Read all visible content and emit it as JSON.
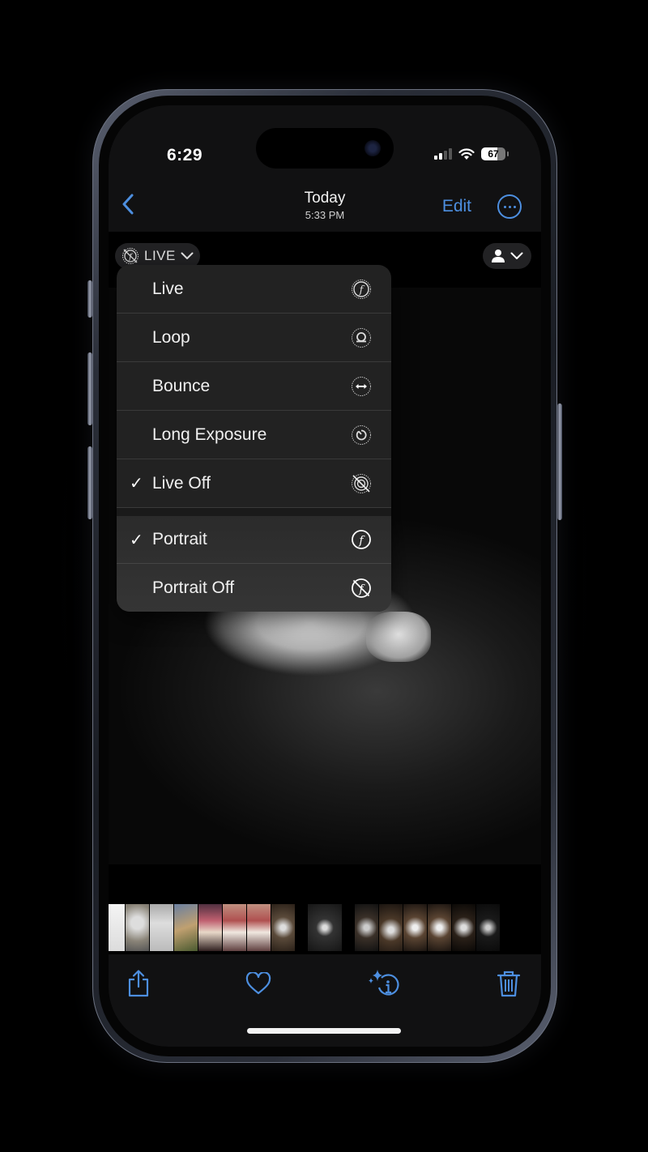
{
  "status_bar": {
    "time": "6:29",
    "battery": "67",
    "battery_level_percent": 67,
    "signal_bars_active": 2,
    "signal_bars_total": 4
  },
  "nav": {
    "back_icon": "chevron-left-icon",
    "title": "Today",
    "subtitle": "5:33 PM",
    "edit_label": "Edit",
    "more_icon": "ellipsis-circle-icon"
  },
  "photo_controls": {
    "live_pill_label": "LIVE",
    "live_pill_icon": "live-photo-off-icon",
    "person_pill_icon": "person-icon"
  },
  "menu": {
    "group1": [
      {
        "label": "Live",
        "icon": "live-photo-icon",
        "checked": false
      },
      {
        "label": "Loop",
        "icon": "loop-icon",
        "checked": false
      },
      {
        "label": "Bounce",
        "icon": "bounce-icon",
        "checked": false
      },
      {
        "label": "Long Exposure",
        "icon": "long-exposure-icon",
        "checked": false
      },
      {
        "label": "Live Off",
        "icon": "live-off-icon",
        "checked": true
      }
    ],
    "group2": [
      {
        "label": "Portrait",
        "icon": "portrait-aperture-icon",
        "checked": true
      },
      {
        "label": "Portrait Off",
        "icon": "portrait-off-icon",
        "checked": false
      }
    ],
    "check_glyph": "✓"
  },
  "filmstrip": {
    "thumbnails": [
      {
        "desc": "settings screenshot",
        "color": "#e8e8e8"
      },
      {
        "desc": "appliance photo",
        "color": "#8a8478"
      },
      {
        "desc": "messages screenshot",
        "color": "#b8b8b8"
      },
      {
        "desc": "outdoor sky photo",
        "color": "#7a6a4a"
      },
      {
        "desc": "laptop camera screenshot",
        "color": "#7a4a5a"
      },
      {
        "desc": "laptop photo",
        "color": "#a08070"
      },
      {
        "desc": "laptop photo",
        "color": "#a08070"
      },
      {
        "desc": "cat camera screenshot",
        "color": "#5a4a3a"
      },
      {
        "desc": "cat black and white (current)",
        "color": "#222222"
      },
      {
        "desc": "phone photo of cat",
        "color": "#3a3028"
      },
      {
        "desc": "cat editing screenshot",
        "color": "#4a3828"
      },
      {
        "desc": "cat editing screenshot",
        "color": "#5a4432"
      },
      {
        "desc": "cat editing screenshot",
        "color": "#5a4432"
      },
      {
        "desc": "cat dark screenshot",
        "color": "#2a2018"
      },
      {
        "desc": "cat bw screenshot",
        "color": "#1a1a1a"
      }
    ]
  },
  "toolbar": {
    "share_icon": "share-icon",
    "favorite_icon": "heart-icon",
    "info_icon": "sparkle-info-icon",
    "delete_icon": "trash-icon"
  },
  "colors": {
    "accent": "#4d8fe0",
    "menu_bg": "#222222",
    "header_bg": "#111112"
  }
}
